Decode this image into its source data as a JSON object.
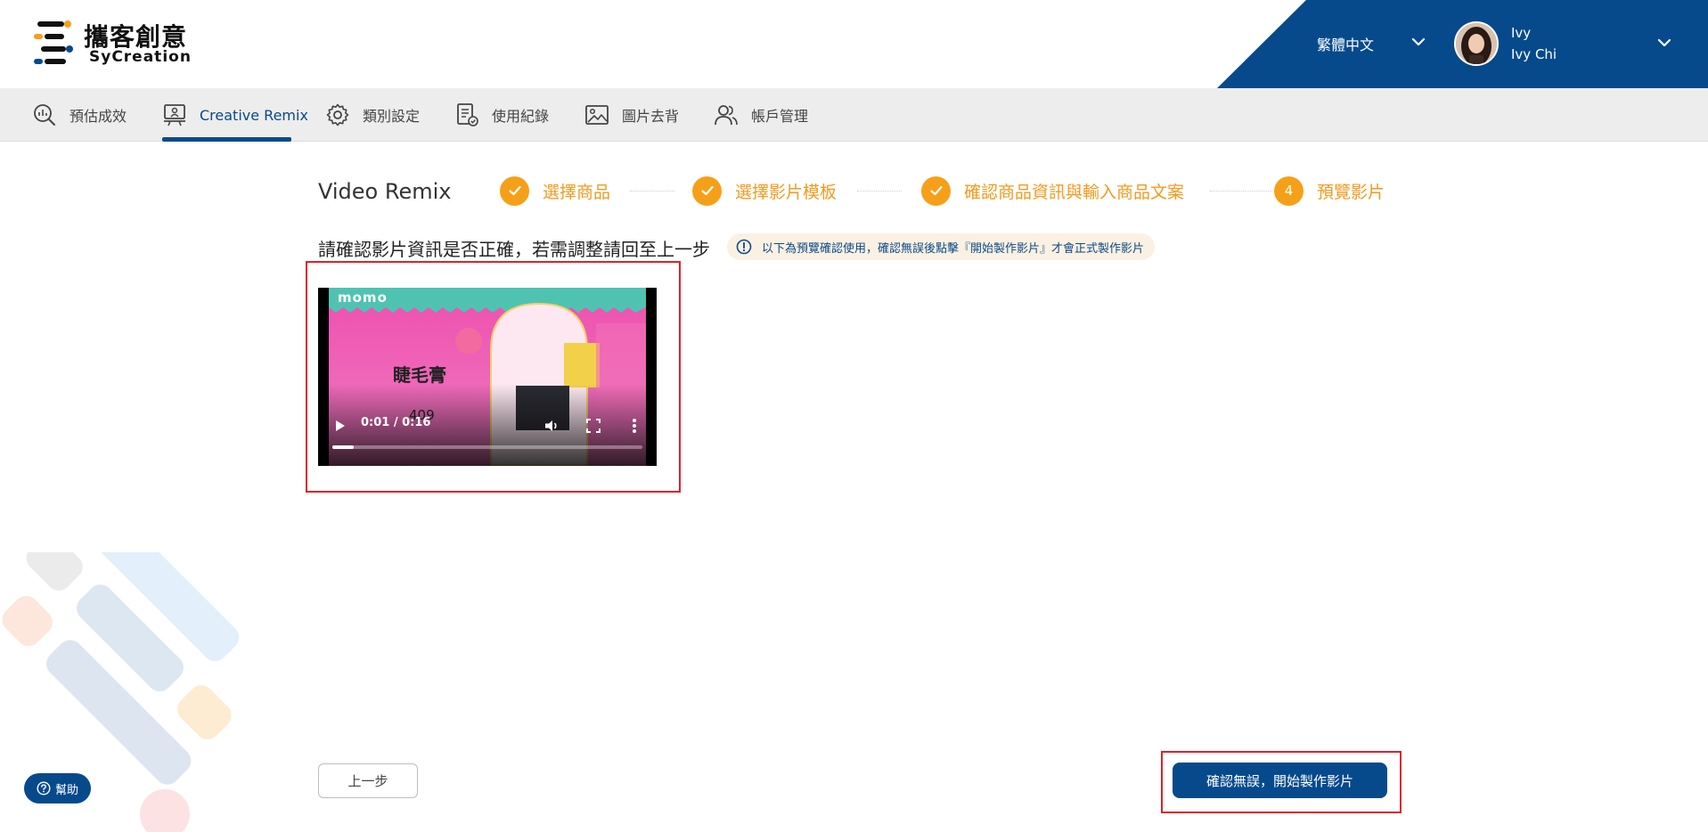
{
  "brand": {
    "name_zh": "攜客創意",
    "name_en": "SyCreation",
    "colors": {
      "primary": "#064a8c",
      "accent": "#f6a019"
    }
  },
  "header": {
    "language": "繁體中文",
    "user": {
      "short_name": "Ivy",
      "full_name": "Ivy Chi"
    }
  },
  "nav": {
    "items": [
      {
        "label": "預估成效",
        "icon": "analytics-icon"
      },
      {
        "label": "Creative Remix",
        "icon": "presentation-icon",
        "active": true
      },
      {
        "label": "類別設定",
        "icon": "gear-icon"
      },
      {
        "label": "使用紀錄",
        "icon": "log-icon"
      },
      {
        "label": "圖片去背",
        "icon": "image-icon"
      },
      {
        "label": "帳戶管理",
        "icon": "users-icon"
      }
    ]
  },
  "page": {
    "title": "Video Remix",
    "steps": [
      {
        "label": "選擇商品",
        "state": "done"
      },
      {
        "label": "選擇影片模板",
        "state": "done"
      },
      {
        "label": "確認商品資訊與輸入商品文案",
        "state": "done"
      },
      {
        "label": "預覽影片",
        "state": "current",
        "number": "4"
      }
    ],
    "instruction": "請確認影片資訊是否正確，若需調整請回至上一步",
    "notice": "以下為預覽確認使用，確認無誤後點擊『開始製作影片』才會正式製作影片"
  },
  "video": {
    "brand_overlay": "momo",
    "product_text": "睫毛膏",
    "price_text": "409",
    "time_display": "0:01 / 0:16",
    "progress": 0.07
  },
  "actions": {
    "prev_label": "上一步",
    "confirm_label": "確認無誤，開始製作影片"
  },
  "help": {
    "label": "幫助"
  }
}
